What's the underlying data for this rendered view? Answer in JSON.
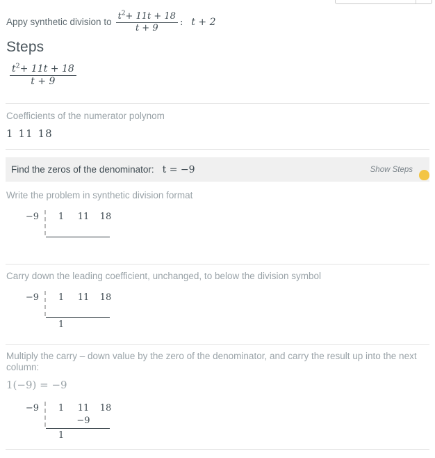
{
  "top_widget": {
    "present": true
  },
  "prompt": {
    "lead": "Appy synthetic division to",
    "numerator_base": "t",
    "numerator_exp": "2",
    "numerator_rest": "+ 11t + 18",
    "denominator": "t + 9",
    "colon": ":",
    "answer": "t + 2"
  },
  "steps_heading": "Steps",
  "expression": {
    "numerator_base": "t",
    "numerator_exp": "2",
    "numerator_rest": "+ 11t + 18",
    "denominator": "t + 9"
  },
  "coefficients_label": "Coefficients of the numerator polynom",
  "coefficients": [
    "1",
    "11",
    "18"
  ],
  "zeros_bar": {
    "label": "Find the zeros of the denominator:",
    "value": "t = −9",
    "show_steps": "Show Steps",
    "bulb_color": "#f3c544"
  },
  "step1": {
    "instruction": "Write the problem in synthetic division format",
    "divisor": "−9",
    "row_top": [
      "1",
      "11",
      "18"
    ],
    "row_mid": [
      "",
      "",
      ""
    ],
    "row_bottom": [
      "",
      "",
      ""
    ]
  },
  "step2": {
    "instruction": "Carry down the leading coefficient, unchanged, to below the division symbol",
    "divisor": "−9",
    "row_top": [
      "1",
      "11",
      "18"
    ],
    "row_mid": [
      "",
      "",
      ""
    ],
    "row_bottom": [
      "1",
      "",
      ""
    ]
  },
  "step3": {
    "instruction": "Multiply the carry – down value by the zero of the denominator, and carry the result up into the next column:",
    "equation": "1(−9) = −9",
    "divisor": "−9",
    "row_top": [
      "1",
      "11",
      "18"
    ],
    "row_mid": [
      "",
      "−9",
      ""
    ],
    "row_bottom": [
      "1",
      "",
      ""
    ]
  },
  "colors": {
    "muted_text": "#9aa3a8",
    "math_text": "#3f4b52",
    "separator": "#e2e2e2",
    "highlight_bar": "#f0f0f0",
    "accent": "#f3c544"
  }
}
